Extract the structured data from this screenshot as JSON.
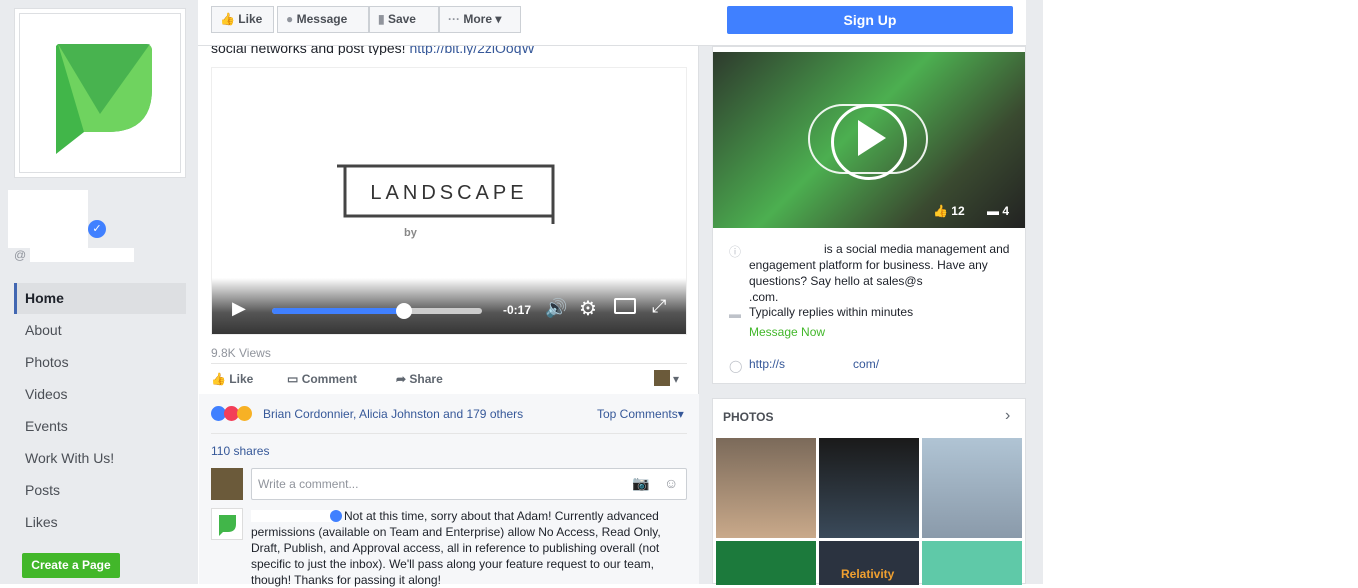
{
  "sidebar": {
    "handle_prefix": "@",
    "nav": [
      "Home",
      "About",
      "Photos",
      "Videos",
      "Events",
      "Work With Us!",
      "Posts",
      "Likes"
    ],
    "create_page": "Create a Page"
  },
  "toolbar": {
    "like": "Like",
    "message": "Message",
    "save": "Save",
    "more": "More",
    "signup": "Sign Up"
  },
  "post": {
    "text_partial": "social networks and post types!",
    "link": "http://bit.ly/2zlOoqW",
    "video_logo": "LANDSCAPE",
    "video_by": "by",
    "video_time": "-0:17",
    "progress": 0.5,
    "views": "9.8K Views",
    "actions": [
      "Like",
      "Comment",
      "Share"
    ],
    "reactions_text": "Brian Cordonnier, Alicia Johnston and 179 others",
    "top_comments": "Top Comments",
    "shares": "110 shares",
    "comment_placeholder": "Write a comment...",
    "reply_text": "Not at this time, sorry about that Adam! Currently advanced permissions (available on Team and Enterprise) allow No Access, Read Only, Draft, Publish, and Approval access, all in reference to publishing overall (not specific to just the inbox). We'll pass along your feature request to our team, though! Thanks for passing it along!"
  },
  "about": {
    "video_likes": "12",
    "video_comments": "4",
    "description": "is a social media management and engagement platform for business. Have any questions? Say hello at sales@s",
    "description_end": ".com.",
    "replies": "Typically replies within minutes",
    "message_now": "Message Now",
    "website_start": "http://s",
    "website_end": "com/"
  },
  "photos": {
    "title": "PHOTOS",
    "photo4_text": "Relativity"
  }
}
